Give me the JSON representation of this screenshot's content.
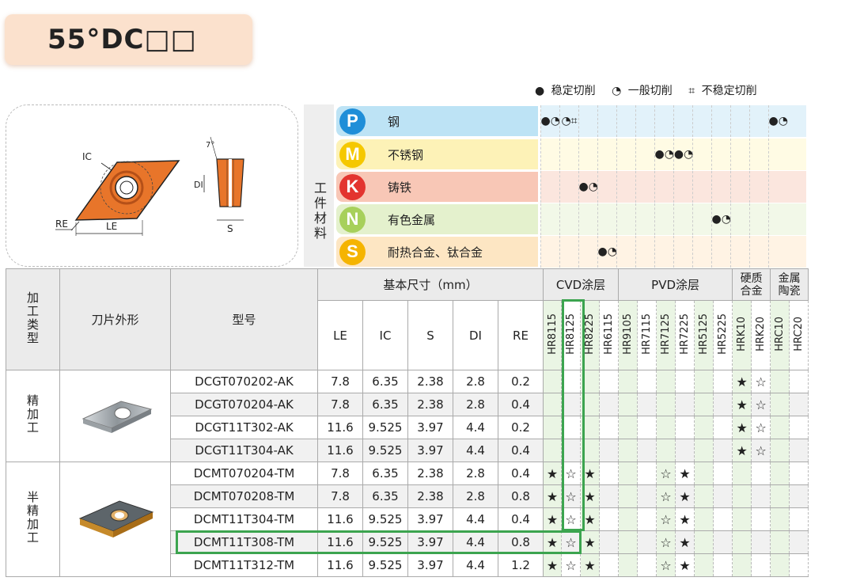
{
  "title": "55°DC□□",
  "legend": [
    {
      "icon": "●",
      "label": "稳定切削"
    },
    {
      "icon": "◔",
      "label": "一般切削"
    },
    {
      "icon": "⌗",
      "label": "不稳定切削"
    }
  ],
  "diagram": {
    "ic": "IC",
    "re": "RE",
    "le": "LE",
    "di": "DI",
    "s": "S",
    "angle": "7°"
  },
  "material_label": "工件材料",
  "materials": [
    {
      "code": "P",
      "name": "钢",
      "color": "#1f8ed8",
      "bg": "#bde3f5",
      "row_bg": "#e2f2fa"
    },
    {
      "code": "M",
      "name": "不锈钢",
      "color": "#f5c800",
      "bg": "#fdf2b7",
      "row_bg": "#fffbe4"
    },
    {
      "code": "K",
      "name": "铸铁",
      "color": "#e3342f",
      "bg": "#f8c7b6",
      "row_bg": "#fbe6de"
    },
    {
      "code": "N",
      "name": "有色金属",
      "color": "#a7d05b",
      "bg": "#e4f1cd",
      "row_bg": "#f2f8e8"
    },
    {
      "code": "S",
      "name": "耐热合金、钛合金",
      "color": "#f5b400",
      "bg": "#fde6c3",
      "row_bg": "#fff3e4"
    }
  ],
  "material_marks": {
    "P": [
      [
        "●",
        "◔"
      ],
      [
        "◔",
        "⌗"
      ],
      [],
      [],
      [],
      [],
      [],
      [],
      [],
      [],
      [],
      [],
      [
        "●",
        "◔"
      ]
    ],
    "M": [
      [],
      [],
      [],
      [],
      [],
      [],
      [
        "●◔",
        "●◔"
      ],
      [],
      [],
      [],
      [],
      [],
      []
    ],
    "K": [
      [],
      [],
      [
        "●◔"
      ],
      [],
      [],
      [],
      [],
      [],
      [],
      [],
      [],
      [],
      []
    ],
    "N": [
      [],
      [],
      [],
      [],
      [],
      [],
      [],
      [],
      [],
      [
        "●",
        "◔"
      ],
      [],
      [],
      []
    ],
    "S": [
      [],
      [],
      [],
      [
        "●",
        "◔"
      ],
      [],
      [],
      [],
      [],
      [],
      [],
      [],
      [],
      []
    ]
  },
  "table": {
    "h_type": "加工类型",
    "h_shape": "刀片外形",
    "h_model": "型号",
    "h_dims": "基本尺寸（mm）",
    "h_cvd": "CVD涂层",
    "h_pvd": "PVD涂层",
    "h_carbide": "硬质合金",
    "h_ceramic": "金属陶瓷",
    "dim_cols": [
      "LE",
      "IC",
      "S",
      "DI",
      "RE"
    ],
    "grades": [
      "HR8115",
      "HR8125",
      "HR8225",
      "HR6115",
      "HR9105",
      "HR7115",
      "HR7125",
      "HR7225",
      "HR5125",
      "HR5225",
      "HRK10",
      "HRK20",
      "HRC10",
      "HRC20"
    ],
    "groups": [
      {
        "type": "精加工",
        "rows": [
          {
            "model": "DCGT070202-AK",
            "dims": [
              "7.8",
              "6.35",
              "2.38",
              "2.8",
              "0.2"
            ],
            "marks": [
              "",
              "",
              "",
              "",
              "",
              "",
              "",
              "",
              "",
              "",
              "★",
              "☆",
              "",
              ""
            ]
          },
          {
            "model": "DCGT070204-AK",
            "dims": [
              "7.8",
              "6.35",
              "2.38",
              "2.8",
              "0.4"
            ],
            "marks": [
              "",
              "",
              "",
              "",
              "",
              "",
              "",
              "",
              "",
              "",
              "★",
              "☆",
              "",
              ""
            ]
          },
          {
            "model": "DCGT11T302-AK",
            "dims": [
              "11.6",
              "9.525",
              "3.97",
              "4.4",
              "0.2"
            ],
            "marks": [
              "",
              "",
              "",
              "",
              "",
              "",
              "",
              "",
              "",
              "",
              "★",
              "☆",
              "",
              ""
            ]
          },
          {
            "model": "DCGT11T304-AK",
            "dims": [
              "11.6",
              "9.525",
              "3.97",
              "4.4",
              "0.4"
            ],
            "marks": [
              "",
              "",
              "",
              "",
              "",
              "",
              "",
              "",
              "",
              "",
              "★",
              "☆",
              "",
              ""
            ]
          }
        ]
      },
      {
        "type": "半精加工",
        "rows": [
          {
            "model": "DCMT070204-TM",
            "dims": [
              "7.8",
              "6.35",
              "2.38",
              "2.8",
              "0.4"
            ],
            "marks": [
              "★",
              "☆",
              "★",
              "",
              "",
              "",
              "☆",
              "★",
              "",
              "",
              "",
              "",
              "",
              ""
            ]
          },
          {
            "model": "DCMT070208-TM",
            "dims": [
              "7.8",
              "6.35",
              "2.38",
              "2.8",
              "0.8"
            ],
            "marks": [
              "★",
              "☆",
              "★",
              "",
              "",
              "",
              "☆",
              "★",
              "",
              "",
              "",
              "",
              "",
              ""
            ]
          },
          {
            "model": "DCMT11T304-TM",
            "dims": [
              "11.6",
              "9.525",
              "3.97",
              "4.4",
              "0.4"
            ],
            "marks": [
              "★",
              "☆",
              "★",
              "",
              "",
              "",
              "☆",
              "★",
              "",
              "",
              "",
              "",
              "",
              ""
            ]
          },
          {
            "model": "DCMT11T308-TM",
            "dims": [
              "11.6",
              "9.525",
              "3.97",
              "4.4",
              "0.8"
            ],
            "marks": [
              "★",
              "☆",
              "★",
              "",
              "",
              "",
              "☆",
              "★",
              "",
              "",
              "",
              "",
              "",
              ""
            ]
          },
          {
            "model": "DCMT11T312-TM",
            "dims": [
              "11.6",
              "9.525",
              "3.97",
              "4.4",
              "1.2"
            ],
            "marks": [
              "★",
              "☆",
              "★",
              "",
              "",
              "",
              "☆",
              "★",
              "",
              "",
              "",
              "",
              "",
              ""
            ]
          }
        ]
      }
    ]
  }
}
